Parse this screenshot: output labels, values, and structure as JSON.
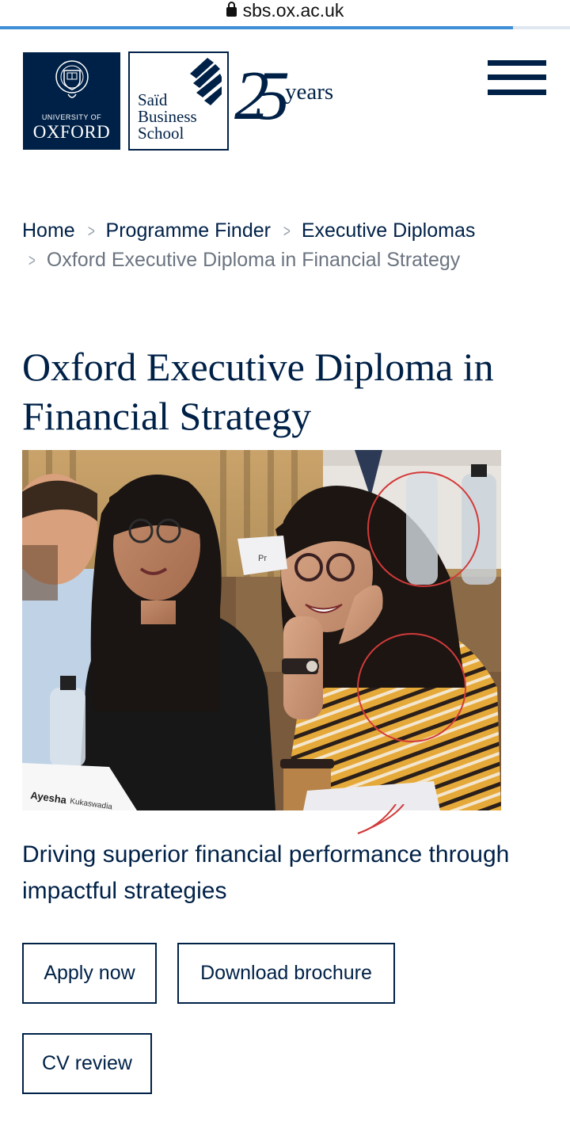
{
  "browser": {
    "url": "sbs.ox.ac.uk",
    "load_progress": 0.9
  },
  "header": {
    "oxford_logo": {
      "line1": "UNIVERSITY OF",
      "line2": "OXFORD",
      "crest_text": "UNIVERSITY OF OXFORD"
    },
    "sbs_logo": {
      "line1": "Saïd",
      "line2": "Business",
      "line3": "School"
    },
    "anniversary": {
      "number": "25",
      "word": "years"
    },
    "menu_icon": "hamburger-menu-icon"
  },
  "breadcrumb": {
    "items": [
      "Home",
      "Programme Finder",
      "Executive Diplomas"
    ],
    "current": "Oxford Executive Diploma in Financial Strategy",
    "separator": ">"
  },
  "main": {
    "title": "Oxford Executive Diploma in Financial Strategy",
    "hero": {
      "name_card_first": "Ayesha",
      "name_card_last": "Kukaswadia",
      "tent_card": "Pr"
    },
    "tagline": "Driving superior financial performance through impactful strategies",
    "buttons": {
      "apply": "Apply now",
      "brochure": "Download brochure",
      "cv": "CV review"
    }
  },
  "colors": {
    "brand_navy": "#002147",
    "progress_blue": "#3f8fd6",
    "annotation_red": "#d23a3a"
  }
}
